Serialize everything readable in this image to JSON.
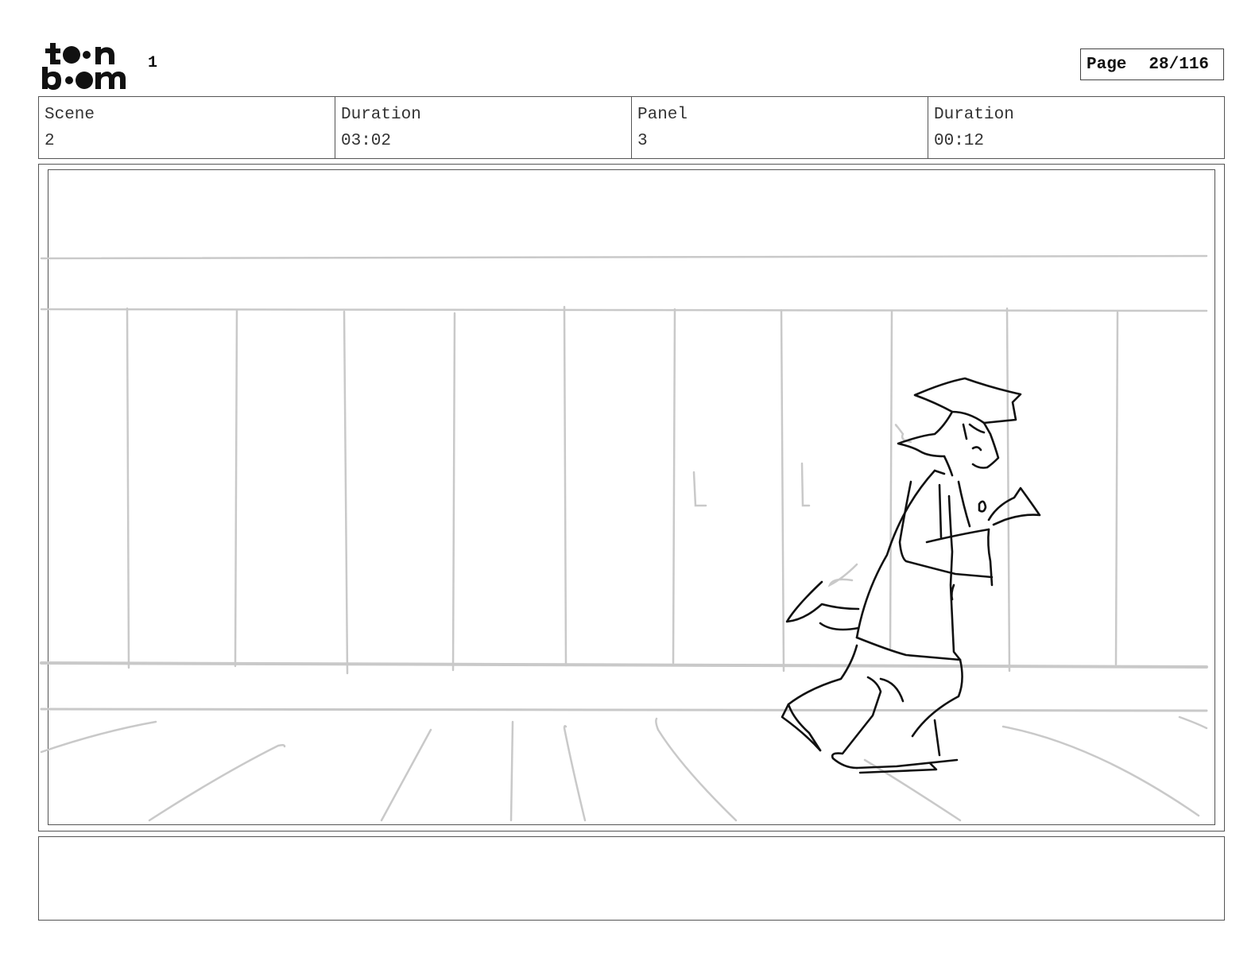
{
  "header": {
    "logo_text": "toon boom",
    "board_number": "1",
    "page_label": "Page",
    "page_value": "28/116"
  },
  "info": {
    "scene_label": "Scene",
    "scene_value": "2",
    "scene_duration_label": "Duration",
    "scene_duration_value": "03:02",
    "panel_label": "Panel",
    "panel_value": "3",
    "panel_duration_label": "Duration",
    "panel_duration_value": "00:12"
  },
  "notes": {
    "text": ""
  }
}
